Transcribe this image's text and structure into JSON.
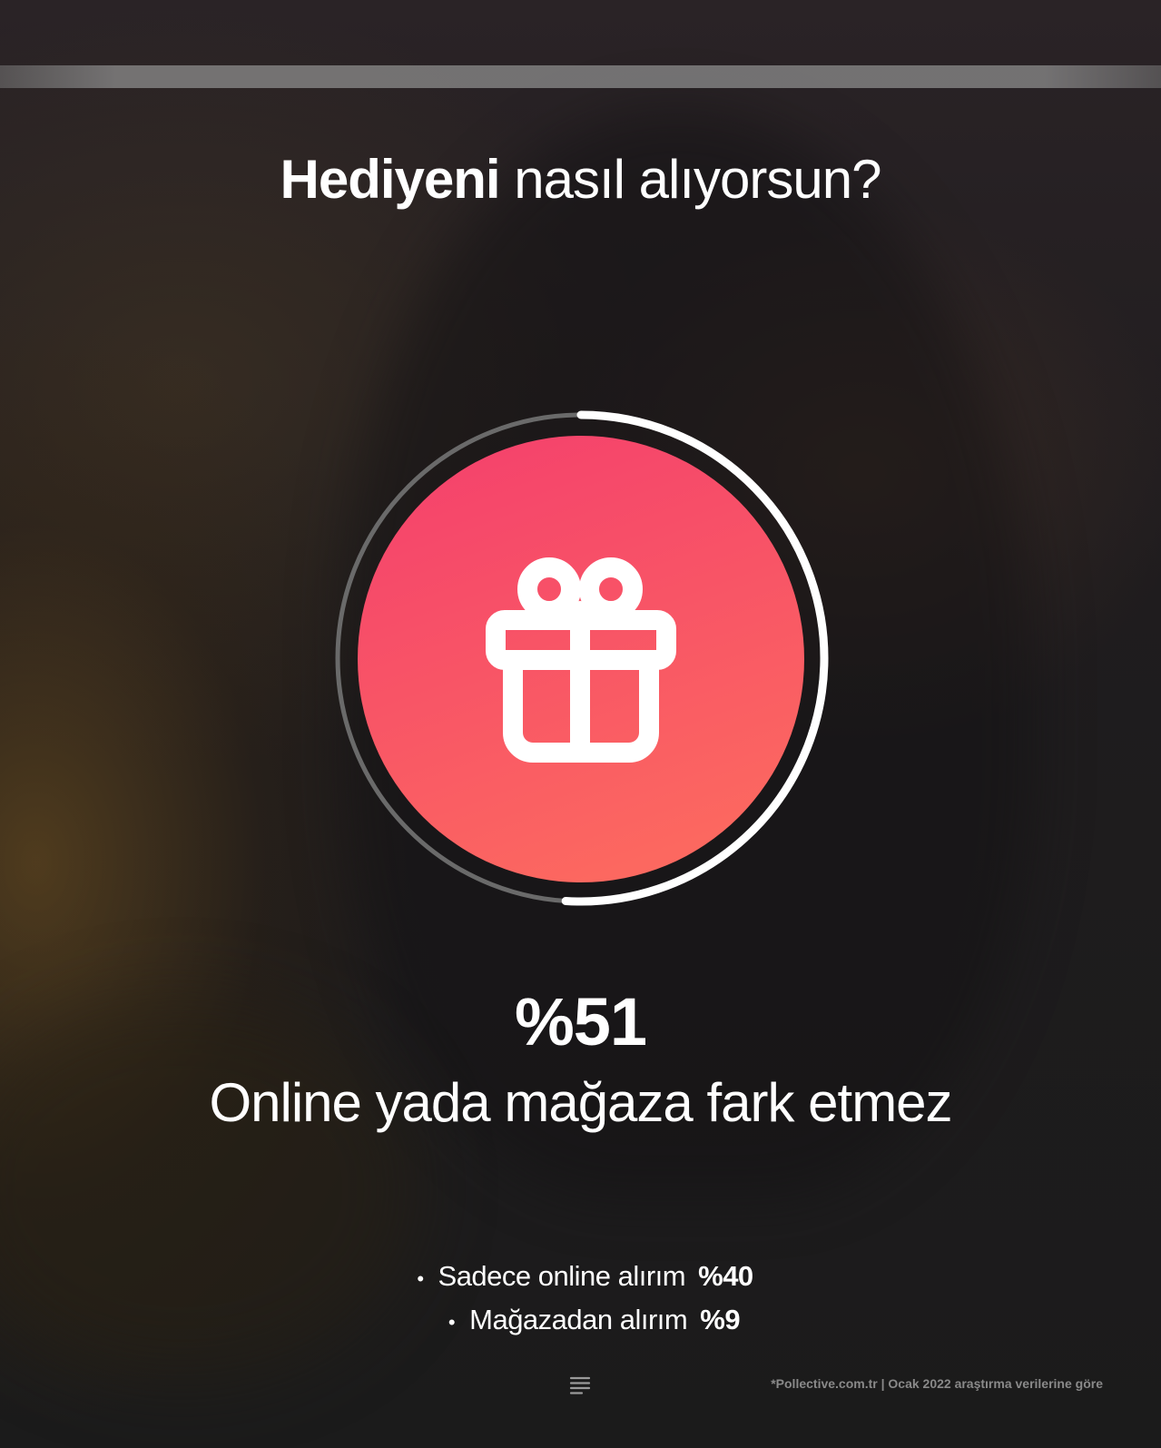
{
  "story": {
    "progress_fraction": 0
  },
  "title": {
    "bold": "Hediyeni",
    "light": "nasıl alıyorsun?"
  },
  "main_stat": {
    "value": "%51",
    "label": "Online yada mağaza fark etmez",
    "ring_fraction": 0.51,
    "icon": "gift-icon"
  },
  "bullets": [
    {
      "label": "Sadece online alırım",
      "value": "%40"
    },
    {
      "label": "Mağazadan alırım",
      "value": "%9"
    }
  ],
  "footer": {
    "icon": "menu-lines-icon",
    "source_note": "*Pollective.com.tr | Ocak 2022 araştırma verilerine göre"
  },
  "colors": {
    "accent_start": "#f43f6d",
    "accent_end": "#fd6e5e",
    "ring": "#ffffff",
    "ring_track": "#6a6a6a"
  }
}
